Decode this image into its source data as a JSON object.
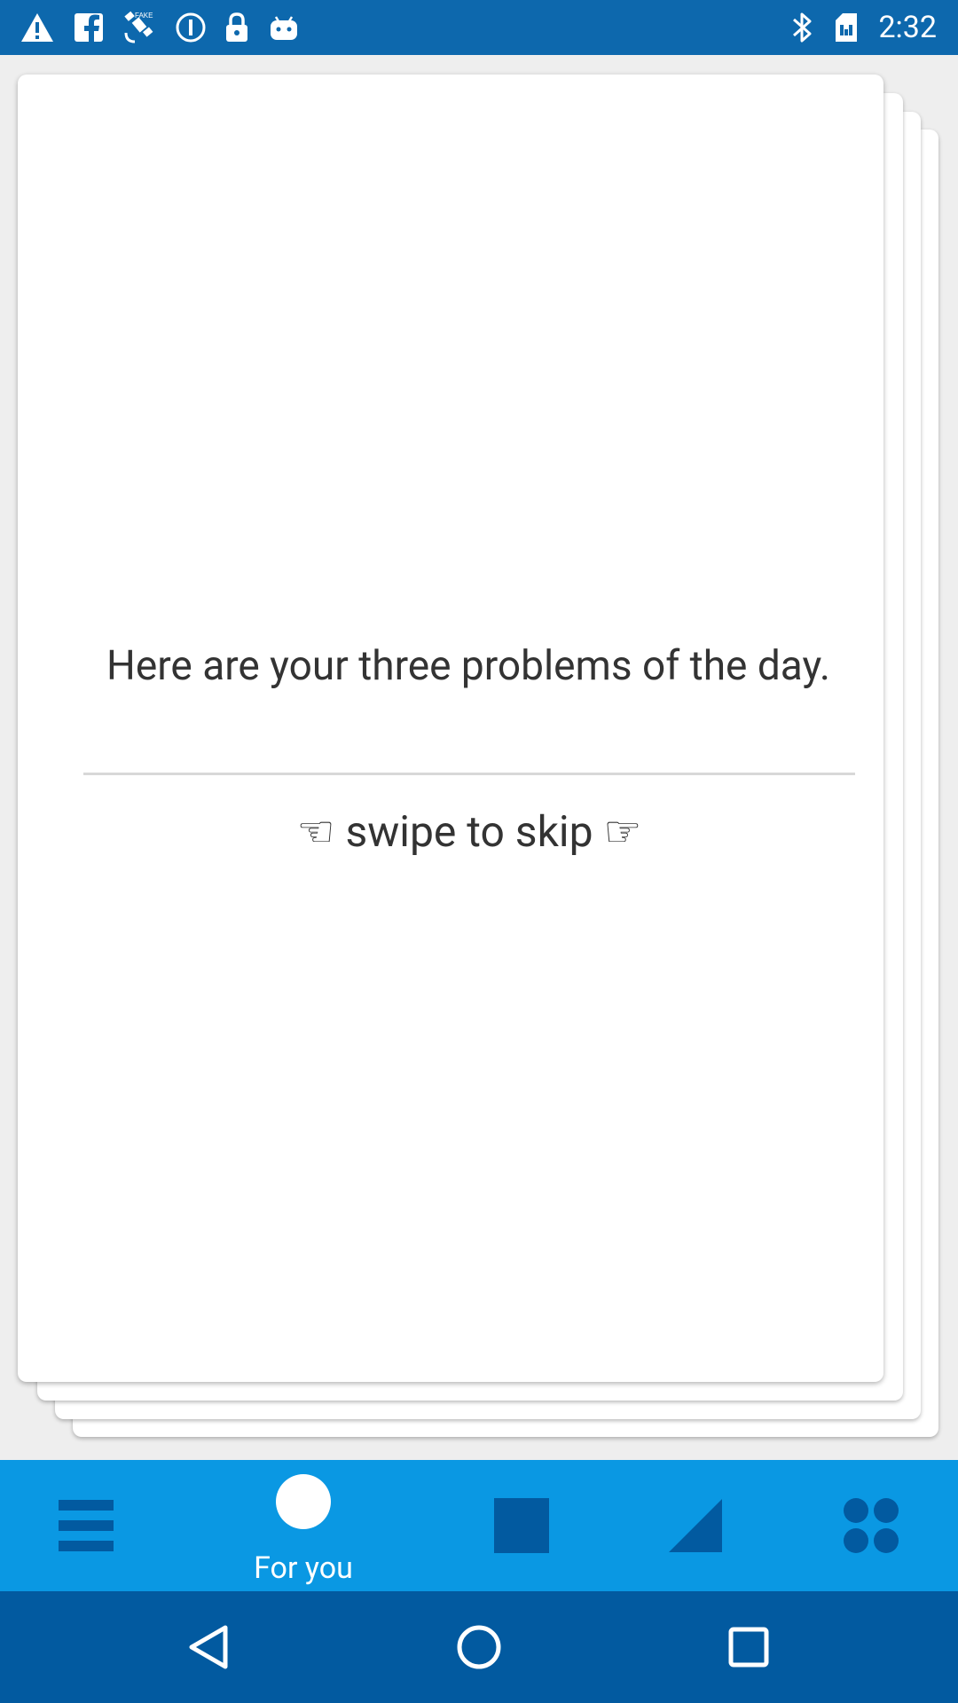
{
  "status_bar": {
    "time": "2:32",
    "left_icons": [
      "warning-icon",
      "facebook-icon",
      "satellite-icon",
      "info-circle-icon",
      "lock-icon",
      "android-icon"
    ],
    "right_icons": [
      "bluetooth-icon",
      "sim-card-icon"
    ]
  },
  "card": {
    "title": "Here are your three problems of the day.",
    "hint": "☜ swipe to skip ☞"
  },
  "bottom_nav": {
    "items": [
      {
        "icon": "menu-icon",
        "label": ""
      },
      {
        "icon": "circle-icon",
        "label": "For you"
      },
      {
        "icon": "square-icon",
        "label": ""
      },
      {
        "icon": "triangle-icon",
        "label": ""
      },
      {
        "icon": "dots-grid-icon",
        "label": ""
      }
    ],
    "selected": "For you"
  },
  "system_nav": [
    "back-icon",
    "home-icon",
    "recents-icon"
  ],
  "colors": {
    "status_bar": "#0d68ad",
    "app_nav": "#0a98e3",
    "system_nav": "#025aa0",
    "card_bg": "#ffffff",
    "page_bg": "#eeeeee"
  }
}
